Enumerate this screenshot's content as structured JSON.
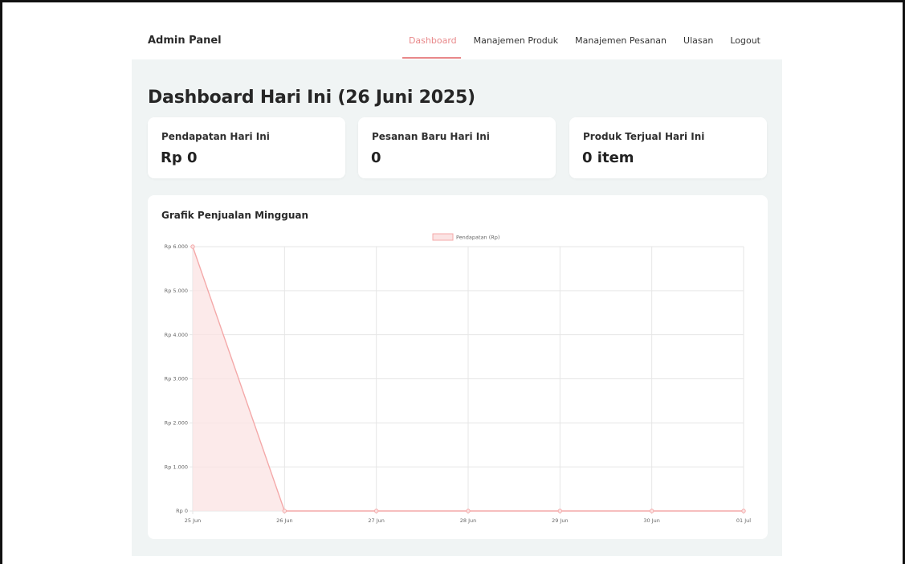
{
  "header": {
    "brand": "Admin Panel",
    "nav": [
      {
        "label": "Dashboard",
        "active": true
      },
      {
        "label": "Manajemen Produk",
        "active": false
      },
      {
        "label": "Manajemen Pesanan",
        "active": false
      },
      {
        "label": "Ulasan",
        "active": false
      },
      {
        "label": "Logout",
        "active": false
      }
    ]
  },
  "page": {
    "title": "Dashboard Hari Ini (26 Juni 2025)"
  },
  "cards": [
    {
      "label": "Pendapatan Hari Ini",
      "value": "Rp 0"
    },
    {
      "label": "Pesanan Baru Hari Ini",
      "value": "0"
    },
    {
      "label": "Produk Terjual Hari Ini",
      "value": "0 item"
    }
  ],
  "colors": {
    "accent": "#e8888a",
    "background": "#f0f4f4",
    "series_line": "#f4a9a9",
    "series_fill": "#fbe3e3"
  },
  "chart_data": {
    "type": "area",
    "title": "Grafik Penjualan Mingguan",
    "x": [
      "25 Jun",
      "26 Jun",
      "27 Jun",
      "28 Jun",
      "29 Jun",
      "30 Jun",
      "01 Jul"
    ],
    "series": [
      {
        "name": "Pendapatan (Rp)",
        "values": [
          6000,
          0,
          0,
          0,
          0,
          0,
          0
        ]
      }
    ],
    "yticks": [
      "Rp 0",
      "Rp 1.000",
      "Rp 2.000",
      "Rp 3.000",
      "Rp 4.000",
      "Rp 5.000",
      "Rp 6.000"
    ],
    "ylim": [
      0,
      6000
    ],
    "grid": true,
    "legend_position": "top-center"
  }
}
